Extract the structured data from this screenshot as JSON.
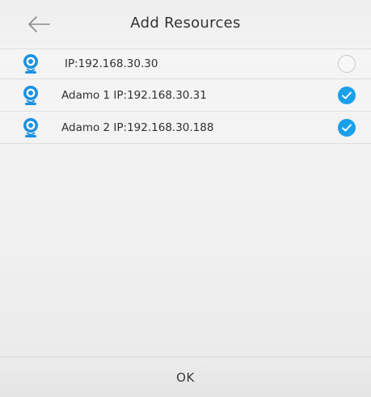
{
  "header": {
    "title": "Add Resources",
    "back_icon": "back-arrow-icon"
  },
  "resources": [
    {
      "label": "IP:192.168.30.30",
      "icon": "camera-icon",
      "selected": false
    },
    {
      "label": "Adamo 1 IP:192.168.30.31",
      "icon": "camera-icon",
      "selected": true
    },
    {
      "label": "Adamo 2 IP:192.168.30.188",
      "icon": "camera-icon",
      "selected": true
    }
  ],
  "footer": {
    "ok_label": "OK"
  },
  "colors": {
    "accent": "#1aa0ea",
    "camera_blue": "#1e90e0"
  }
}
